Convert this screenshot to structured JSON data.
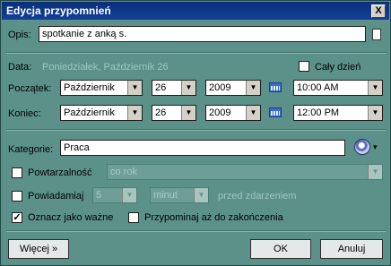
{
  "window": {
    "title": "Edycja przypomnień",
    "close_glyph": "X"
  },
  "opis": {
    "label": "Opis:",
    "value": "spotkanie z anką s."
  },
  "data": {
    "label": "Data:",
    "value": "Poniedziałek, Październik 26",
    "all_day_label": "Cały dzień",
    "all_day_checked": false
  },
  "start": {
    "label": "Początek:",
    "month": "Październik",
    "day": "26",
    "year": "2009",
    "time": "10:00 AM"
  },
  "end": {
    "label": "Koniec:",
    "month": "Październik",
    "day": "26",
    "year": "2009",
    "time": "12:00 PM"
  },
  "category": {
    "label": "Kategorie:",
    "value": "Praca"
  },
  "repeat": {
    "label": "Powtarzalność",
    "checked": false,
    "value": "co rok"
  },
  "notify": {
    "label": "Powiadamiaj",
    "checked": false,
    "amount": "5",
    "unit": "minut",
    "suffix": "przed zdarzeniem"
  },
  "important": {
    "label": "Oznacz jako ważne",
    "checked": true,
    "check_glyph": "✓"
  },
  "remind_until_end": {
    "label": "Przypominaj aż do zakończenia",
    "checked": false
  },
  "buttons": {
    "more": "Więcej »",
    "ok": "OK",
    "cancel": "Anuluj"
  },
  "icons": {
    "dropdown": "▼",
    "small_dropdown": "▾"
  }
}
